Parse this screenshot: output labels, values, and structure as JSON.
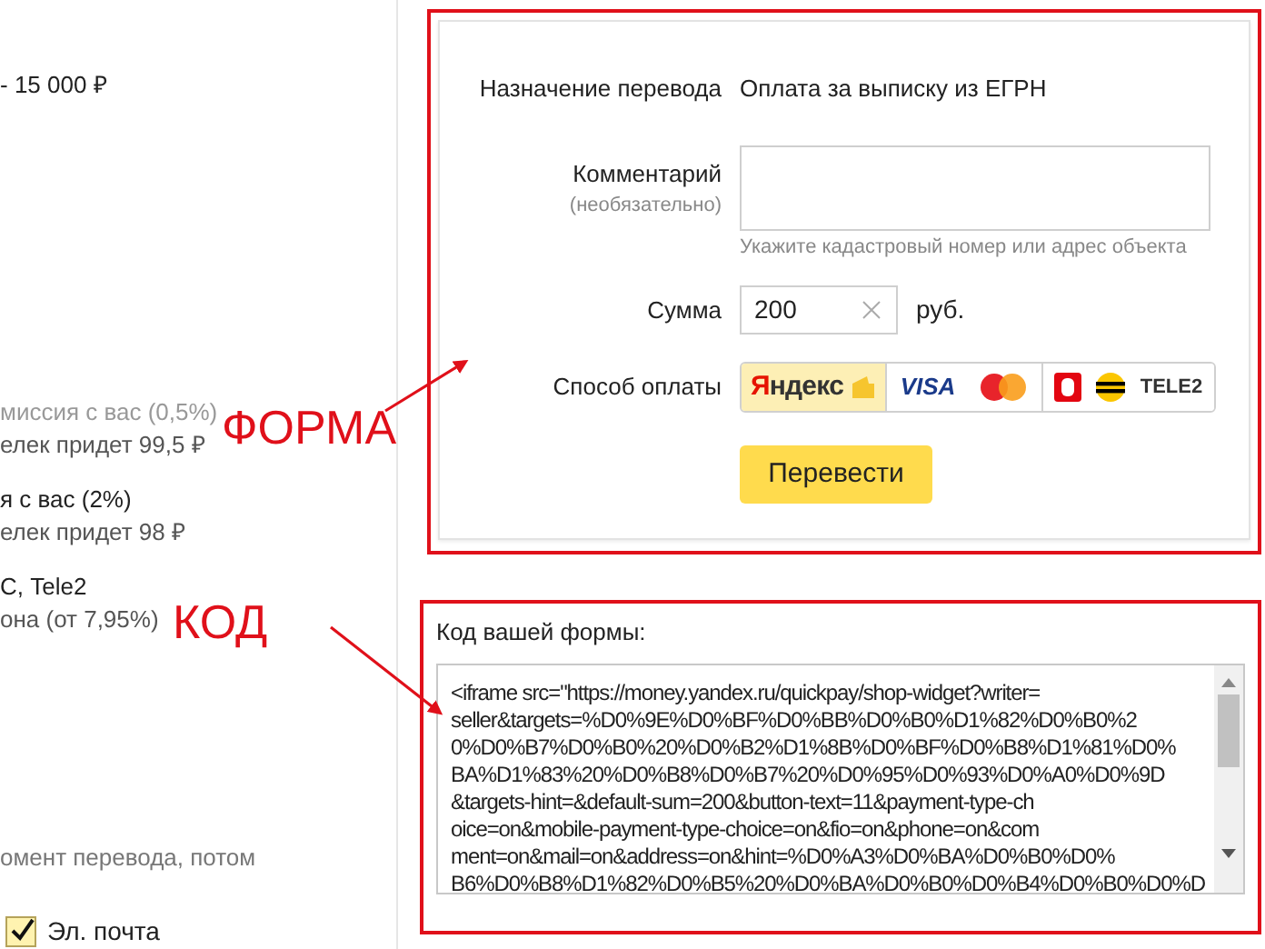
{
  "left_panel": {
    "price": "- 15 000 ₽",
    "options": [
      {
        "title": "миссия с вас (0,5%)",
        "note": "елек придет 99,5 ₽",
        "disabled": true
      },
      {
        "title": "я с вас (2%)",
        "note": "елек придет 98 ₽",
        "disabled": false
      },
      {
        "title": "С, Tele2",
        "note": "она (от 7,95%)",
        "disabled": false
      }
    ],
    "footnote": "омент перевода, потом",
    "checkbox": {
      "label": "Эл. почта",
      "checked": true
    }
  },
  "form": {
    "purpose_label": "Назначение перевода",
    "purpose_value": "Оплата за выписку из ЕГРН",
    "comment_label": "Комментарий",
    "comment_optional": "(необязательно)",
    "comment_hint": "Укажите кадастровый номер или адрес объекта",
    "sum_label": "Сумма",
    "sum_value": "200",
    "currency": "руб.",
    "method_label": "Способ оплаты",
    "methods": [
      {
        "kind": "wallet",
        "label": "Яндекс",
        "selected": true
      },
      {
        "kind": "card",
        "label": "VISA",
        "selected": false
      },
      {
        "kind": "mobile",
        "label": "TELE2",
        "selected": false
      }
    ],
    "submit": "Перевести"
  },
  "code": {
    "title": "Код вашей формы:",
    "lines": [
      "<iframe src=\"https://money.yandex.ru/quickpay/shop-widget?writer=",
      "seller&targets=%D0%9E%D0%BF%D0%BB%D0%B0%D1%82%D0%B0%2",
      "0%D0%B7%D0%B0%20%D0%B2%D1%8B%D0%BF%D0%B8%D1%81%D0%",
      "BA%D1%83%20%D0%B8%D0%B7%20%D0%95%D0%93%D0%A0%D0%9D",
      "&targets-hint=&default-sum=200&button-text=11&payment-type-ch",
      "oice=on&mobile-payment-type-choice=on&fio=on&phone=on&com",
      "ment=on&mail=on&address=on&hint=%D0%A3%D0%BA%D0%B0%D0%",
      "B6%D0%B8%D1%82%D0%B5%20%D0%BA%D0%B0%D0%B4%D0%B0%D0%D"
    ]
  },
  "annotations": [
    {
      "kind": "form",
      "text": "ФОРМА"
    },
    {
      "kind": "code",
      "text": "КОД"
    }
  ]
}
